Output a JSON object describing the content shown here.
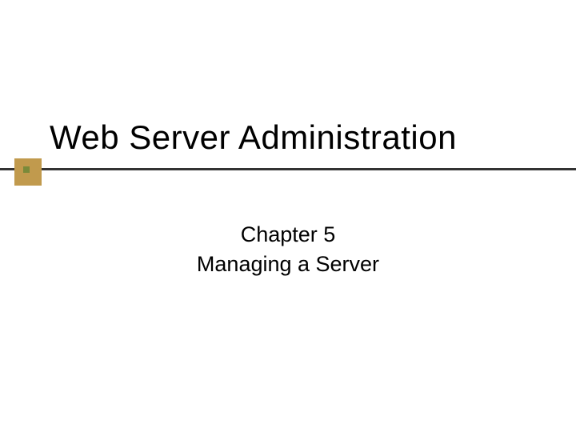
{
  "slide": {
    "title": "Web Server Administration",
    "subtitle_line1": "Chapter 5",
    "subtitle_line2": "Managing a Server"
  },
  "colors": {
    "accent_box": "#c19a4d",
    "accent_square": "#7a8a3a",
    "line": "#333333"
  }
}
